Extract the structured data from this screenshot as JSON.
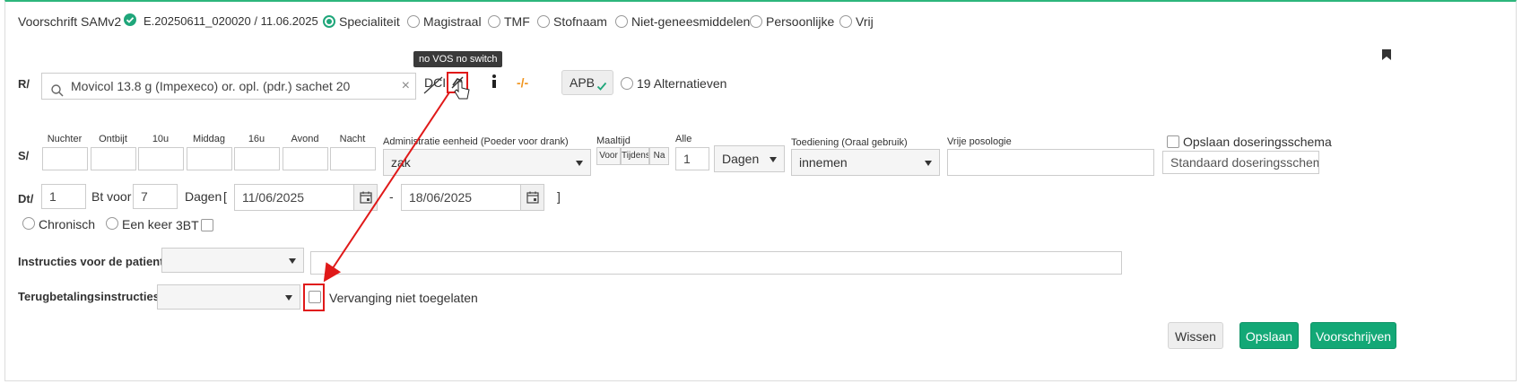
{
  "header": {
    "title": "Voorschrift SAMv2",
    "reference": "E.20250611_020020 / 11.06.2025",
    "types": [
      {
        "label": "Specialiteit",
        "checked": true
      },
      {
        "label": "Magistraal",
        "checked": false
      },
      {
        "label": "TMF",
        "checked": false
      },
      {
        "label": "Stofnaam",
        "checked": false
      },
      {
        "label": "Niet-geneesmiddelen",
        "checked": false
      },
      {
        "label": "Persoonlijke",
        "checked": false
      },
      {
        "label": "Vrij",
        "checked": false
      }
    ]
  },
  "r_row": {
    "label": "R/",
    "product": "Movicol 13.8 g (Impexeco) or. opl. (pdr.) sachet 20",
    "dci_label": "DCI",
    "tooltip": "no VOS no switch",
    "price_text": "-/-",
    "apb_label": "APB",
    "alternatives_label": "19 Alternatieven"
  },
  "s_row": {
    "label": "S/",
    "moments": [
      "Nuchter",
      "Ontbijt",
      "10u",
      "Middag",
      "16u",
      "Avond",
      "Nacht"
    ],
    "admin_unit_label": "Administratie eenheid  (Poeder voor drank)",
    "admin_unit_value": "zak",
    "maaltijd_label": "Maaltijd",
    "maaltijd_options": [
      "Voor",
      "Tijdens",
      "Na"
    ],
    "alle_label": "Alle",
    "alle_value": "1",
    "period_value": "Dagen",
    "toediening_label": "Toediening (Oraal gebruik)",
    "toediening_value": "innemen",
    "vrije_label": "Vrije posologie",
    "opslaan_schema_label": "Opslaan doseringsschema",
    "standaard_placeholder": "Standaard doseringsschema"
  },
  "dt_row": {
    "label": "Dt/",
    "qty": "1",
    "bt_voor_label": "Bt voor",
    "days_value": "7",
    "dagen_label": "Dagen",
    "open_bracket": "[",
    "start_date": "11/06/2025",
    "dash": "-",
    "end_date": "18/06/2025",
    "close_bracket": "]",
    "chronisch_label": "Chronisch",
    "een_keer_label": "Een keer",
    "bt3_label": "3BT"
  },
  "instructions": {
    "patient_label": "Instructies voor de patient",
    "terugbetaling_label": "Terugbetalingsinstructies",
    "vervanging_label": "Vervanging niet toegelaten"
  },
  "actions": {
    "wissen": "Wissen",
    "opslaan": "Opslaan",
    "voorschrijven": "Voorschrijven"
  },
  "colors": {
    "accent": "#13a876",
    "annotation": "#e01919",
    "price": "#f0941e"
  }
}
